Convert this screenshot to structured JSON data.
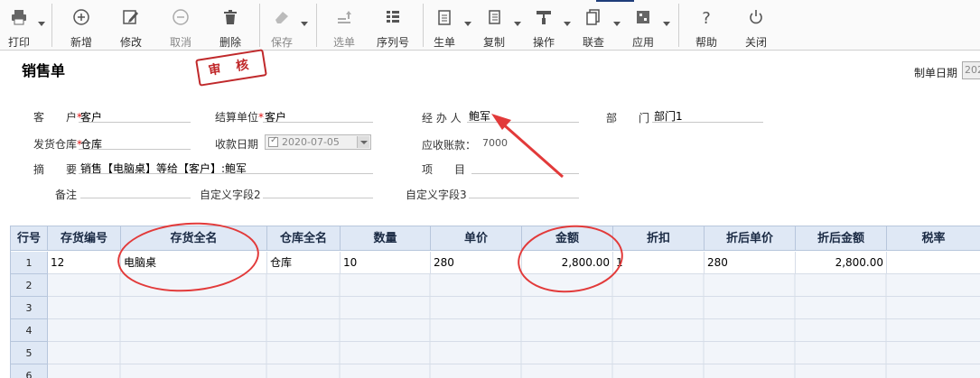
{
  "toolbar": {
    "print": "打印",
    "add": "新增",
    "edit": "修改",
    "cancel": "取消",
    "delete": "删除",
    "save": "保存",
    "select": "选单",
    "serial": "序列号",
    "generate": "生单",
    "copy": "复制",
    "operate": "操作",
    "query": "联查",
    "apply": "应用",
    "help": "帮助",
    "close": "关闭"
  },
  "header": {
    "title": "销售单",
    "stamp": "审 核",
    "date_label": "制单日期",
    "date_value": "202"
  },
  "form": {
    "customer_label": "客　　户",
    "customer_value": "客户",
    "settle_label": "结算单位",
    "settle_value": "客户",
    "handler_label": "经 办 人",
    "handler_value": "鲍军",
    "dept_label": "部　　门",
    "dept_value": "部门1",
    "warehouse_label": "发货仓库",
    "warehouse_value": "仓库",
    "collect_date_label": "收款日期",
    "collect_date_value": "2020-07-05",
    "receivable_label": "应收账款：",
    "receivable_value": "7000",
    "summary_label": "摘　　要",
    "summary_value": "销售【电脑桌】等给【客户】:鲍军",
    "project_label": "项　　目",
    "note_label": "备注",
    "custom2_label": "自定义字段2",
    "custom3_label": "自定义字段3"
  },
  "table": {
    "headers": [
      "行号",
      "存货编号",
      "存货全名",
      "仓库全名",
      "数量",
      "单价",
      "金额",
      "折扣",
      "折后单价",
      "折后金额",
      "税率"
    ],
    "rows": [
      {
        "num": "1",
        "code": "12",
        "name": "电脑桌",
        "warehouse": "仓库",
        "qty": "10",
        "price": "280",
        "amount": "2,800.00",
        "discount": "1",
        "disc_price": "280",
        "disc_amount": "2,800.00",
        "tax": ""
      },
      {
        "num": "2"
      },
      {
        "num": "3"
      },
      {
        "num": "4"
      },
      {
        "num": "5"
      },
      {
        "num": "6"
      }
    ]
  },
  "colors": {
    "annotation_red": "#e23a3a",
    "stamp_red": "#c0292b",
    "grid_header_bg": "#dfe8f5"
  }
}
